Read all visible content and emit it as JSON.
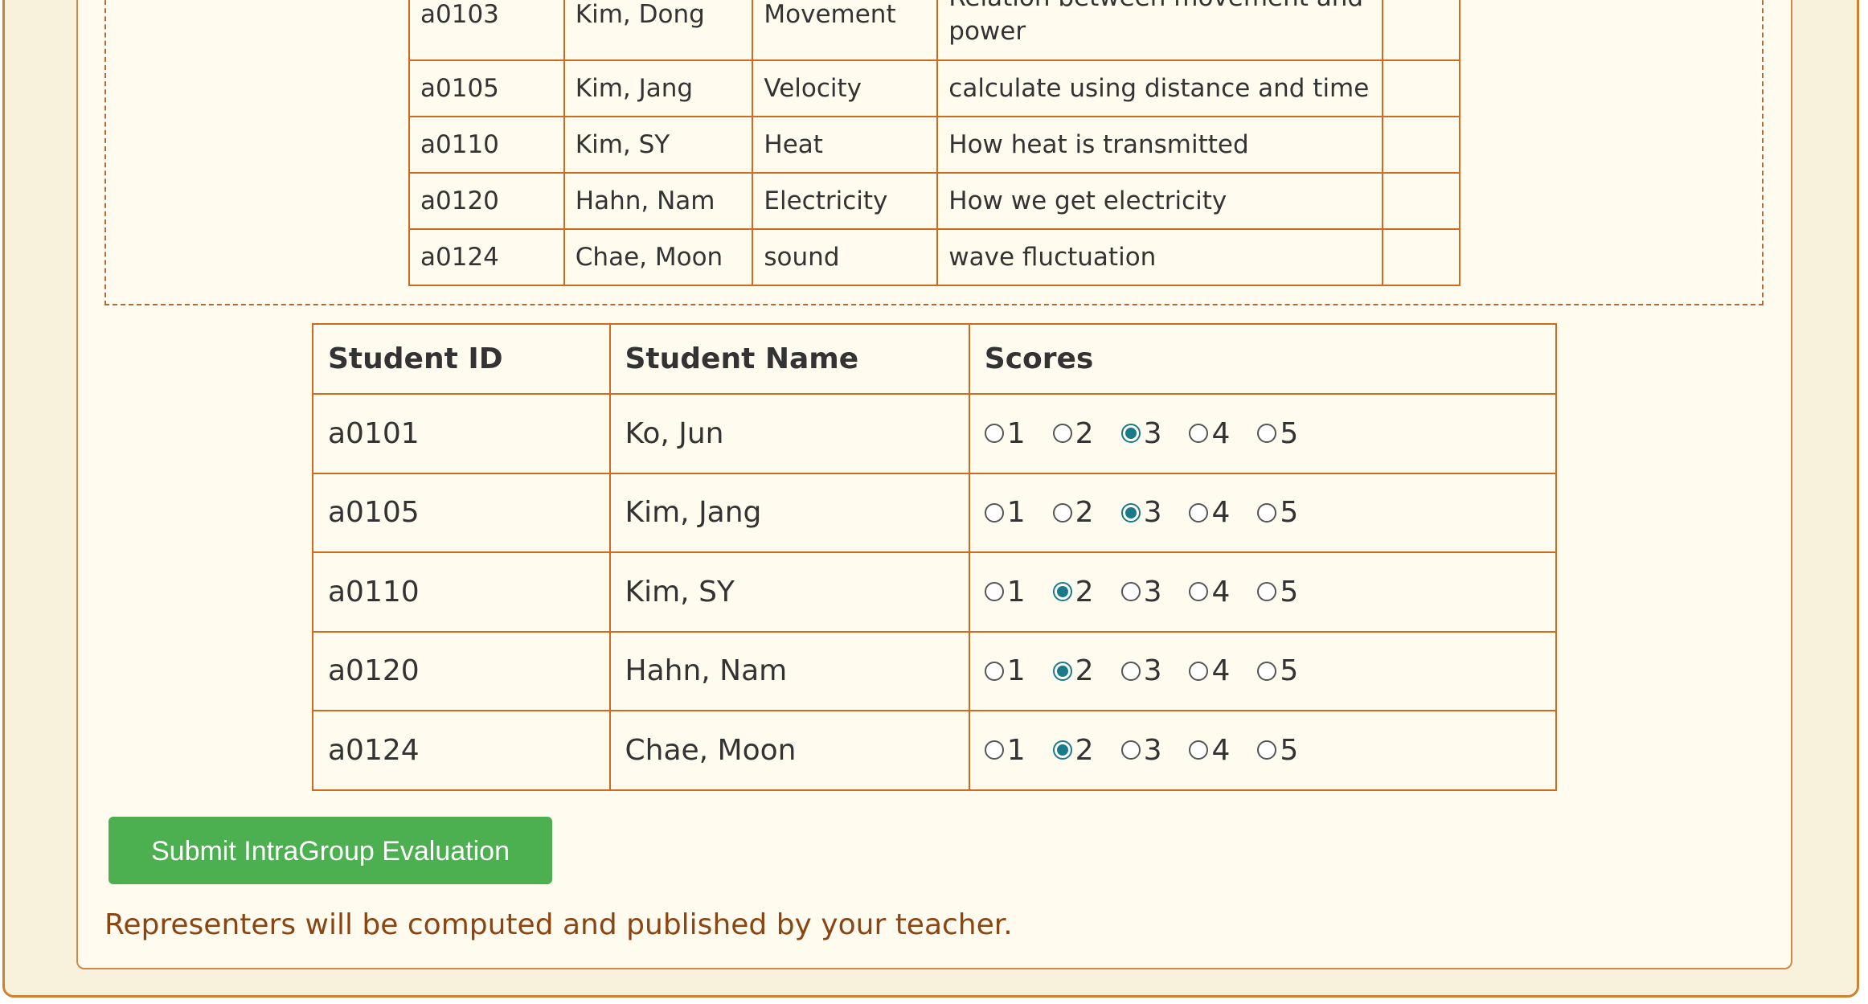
{
  "topics": {
    "rows": [
      {
        "id": "a0103",
        "name": "Kim, Dong",
        "topic": "Movement",
        "question_line1": "Relation between movement and",
        "question_line2": "power",
        "extra": ""
      },
      {
        "id": "a0105",
        "name": "Kim, Jang",
        "topic": "Velocity",
        "question": "calculate using distance and time",
        "extra": ""
      },
      {
        "id": "a0110",
        "name": "Kim, SY",
        "topic": "Heat",
        "question": "How heat is transmitted",
        "extra": ""
      },
      {
        "id": "a0120",
        "name": "Hahn, Nam",
        "topic": "Electricity",
        "question": "How we get electricity",
        "extra": ""
      },
      {
        "id": "a0124",
        "name": "Chae, Moon",
        "topic": "sound",
        "question": "wave fluctuation",
        "extra": ""
      }
    ]
  },
  "scores": {
    "headers": {
      "id": "Student ID",
      "name": "Student Name",
      "scores": "Scores"
    },
    "options": [
      "1",
      "2",
      "3",
      "4",
      "5"
    ],
    "rows": [
      {
        "id": "a0101",
        "name": "Ko, Jun",
        "selected": 3
      },
      {
        "id": "a0105",
        "name": "Kim, Jang",
        "selected": 3
      },
      {
        "id": "a0110",
        "name": "Kim, SY",
        "selected": 2
      },
      {
        "id": "a0120",
        "name": "Hahn, Nam",
        "selected": 2
      },
      {
        "id": "a0124",
        "name": "Chae, Moon",
        "selected": 2
      }
    ]
  },
  "actions": {
    "submit_label": "Submit IntraGroup Evaluation"
  },
  "footer": {
    "note": "Representers will be computed and published by your teacher."
  },
  "colors": {
    "accent": "#4caf50",
    "border": "#d2691e",
    "radio": "#1b7a8a",
    "note": "#8b4513"
  }
}
